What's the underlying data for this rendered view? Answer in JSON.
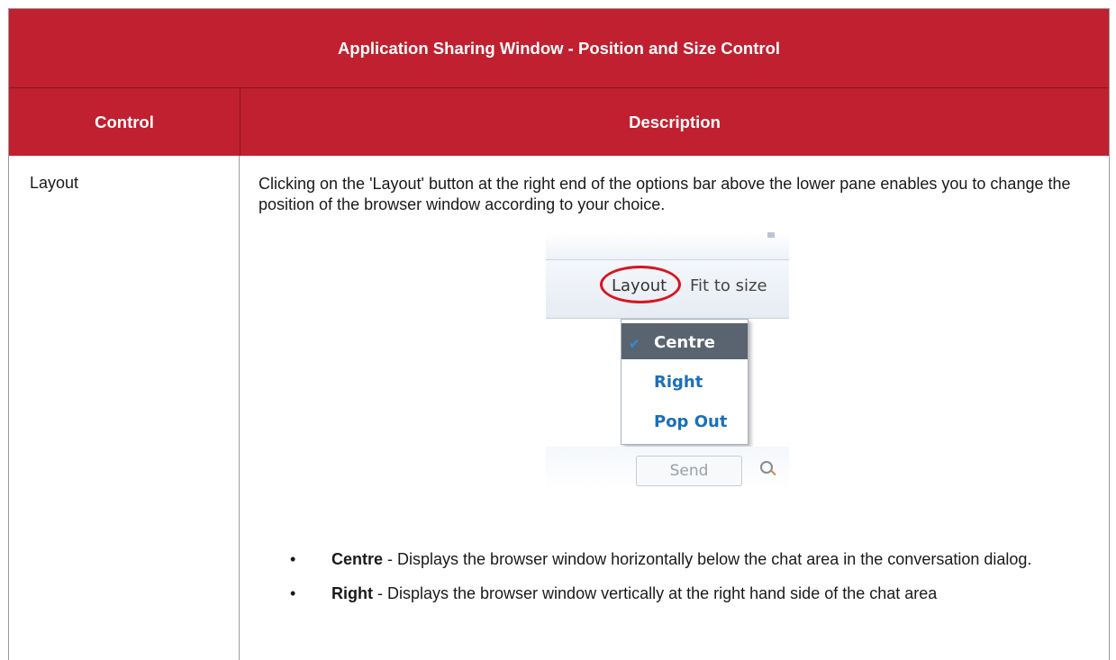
{
  "table": {
    "title": "Application Sharing Window - Position and Size Control",
    "headers": {
      "control": "Control",
      "description": "Description"
    },
    "row": {
      "control": "Layout",
      "description": "Clicking on the 'Layout' button at the right end of the options bar above the lower pane enables you to change the position of the browser window according to your choice.",
      "bullets": [
        {
          "term": "Centre",
          "text": " - Displays the browser window horizontally below the chat area in the conversation dialog."
        },
        {
          "term": "Right",
          "text": " - Displays the browser  window vertically at the right hand side of the chat area"
        }
      ]
    }
  },
  "screenshot": {
    "layout_label": "Layout",
    "fit_label": "Fit to size",
    "menu_items": [
      "Centre",
      "Right",
      "Pop Out"
    ],
    "selected_item": "Centre",
    "send_label": "Send"
  },
  "colors": {
    "header_bg": "#c0202f",
    "accent_ring": "#d8141e",
    "menu_text": "#1b6fb8"
  }
}
